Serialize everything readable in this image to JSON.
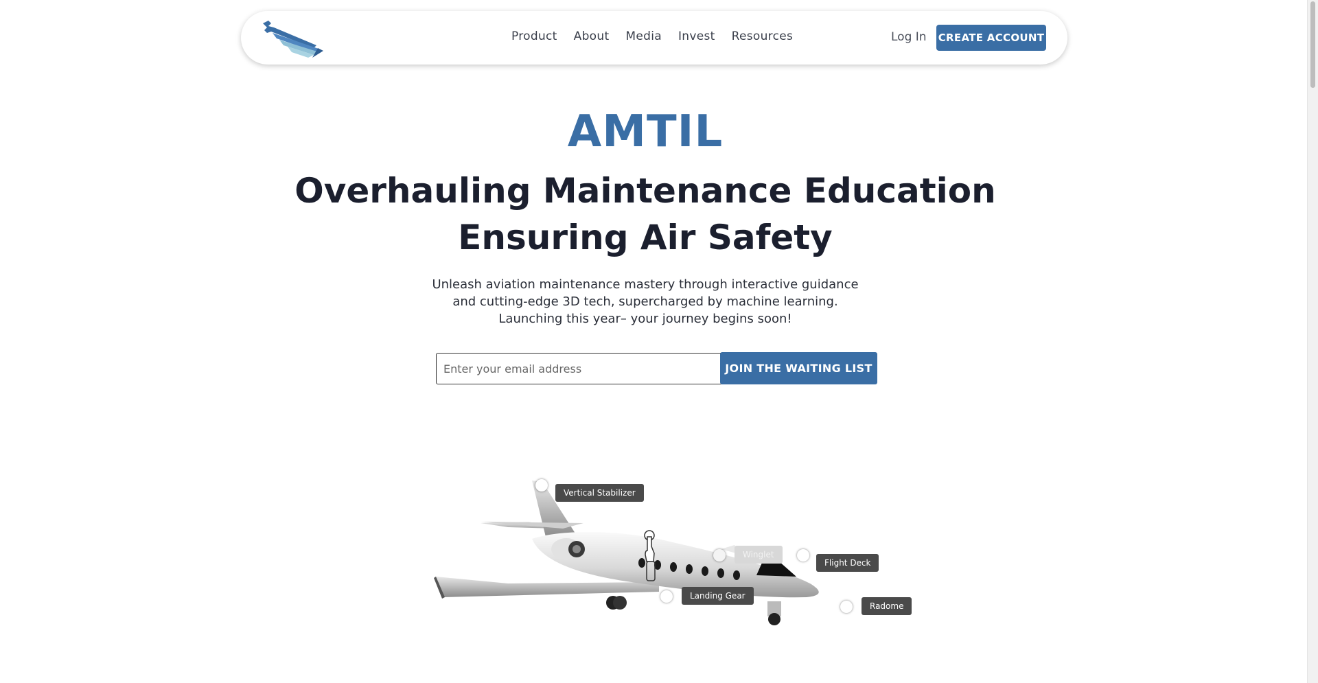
{
  "nav": {
    "logo": "wrench-wing-logo",
    "links": [
      {
        "label": "Product"
      },
      {
        "label": "About"
      },
      {
        "label": "Media"
      },
      {
        "label": "Invest"
      },
      {
        "label": "Resources"
      }
    ],
    "login_label": "Log In",
    "create_account_label": "CREATE ACCOUNT"
  },
  "hero": {
    "brand": "AMTIL",
    "headline_line1": "Overhauling Maintenance Education",
    "headline_line2": "Ensuring Air Safety",
    "sub_line1": "Unleash aviation maintenance mastery through interactive guidance",
    "sub_line2": "and cutting-edge 3D tech, supercharged by machine learning.",
    "sub_line3": "Launching this year– your journey begins soon!",
    "email_placeholder": "Enter your email address",
    "join_label": "JOIN THE WAITING LIST"
  },
  "aircraft": {
    "hotspots": [
      {
        "label": "Vertical Stabilizer"
      },
      {
        "label": "Winglet"
      },
      {
        "label": "Flight Deck"
      },
      {
        "label": "Landing Gear"
      },
      {
        "label": "Radome"
      }
    ]
  },
  "colors": {
    "accent": "#3a6ea5",
    "heading": "#1b1f2e"
  }
}
